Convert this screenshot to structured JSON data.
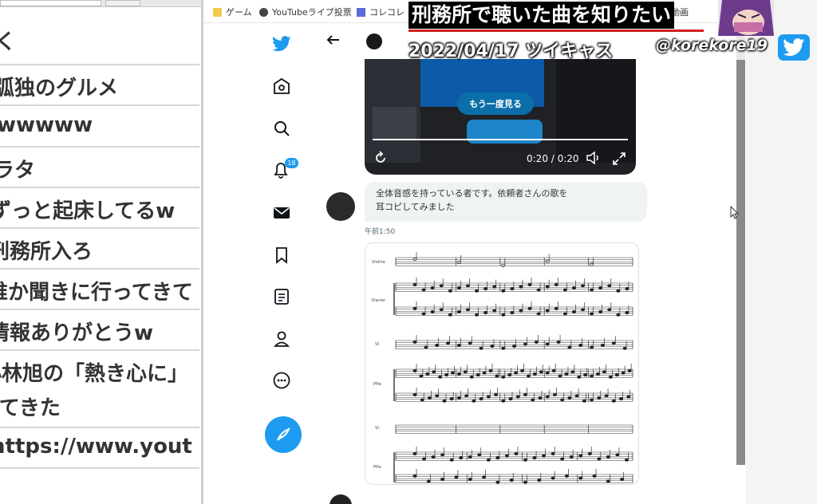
{
  "comments": [
    "弧独のグルメ",
    "wwwww",
    "ラタ",
    "ずっと起床してるw",
    "刑務所入ろ",
    "誰か聞きに行ってきて",
    "情報ありがとうw",
    "小林旭の「熱き心に」",
    "ってきた",
    "https://www.yout"
  ],
  "bookmarks": [
    {
      "icon": "folder-icon",
      "label": "ゲーム"
    },
    {
      "icon": "globe-icon",
      "label": "YouTubeライブ投票"
    },
    {
      "icon": "page-icon",
      "label": "コレコレ"
    }
  ],
  "bookmark_extra": "(94) 動画",
  "overlay": {
    "title": "刑務所で聴いた曲を知りたい",
    "date": "2022/04/17 ツイキャス",
    "handle": "@korekore19"
  },
  "video": {
    "replay_label": "もう一度見る",
    "time": "0:20 / 0:20"
  },
  "tweet": {
    "text_line1": "全体音感を持っている者です。依頼者さんの歌を",
    "text_line2": "耳コピしてみました",
    "timestamp": "午前1:50"
  },
  "notifications_badge": "18",
  "score_labels": {
    "violin": "Violine",
    "klavier": "Klavier",
    "vl": "Vl.",
    "pfte": "Pfte"
  },
  "colors": {
    "twitter_blue": "#1d9bf0",
    "nav_icon": "#0f1419",
    "bubble": "#eff3f4"
  }
}
